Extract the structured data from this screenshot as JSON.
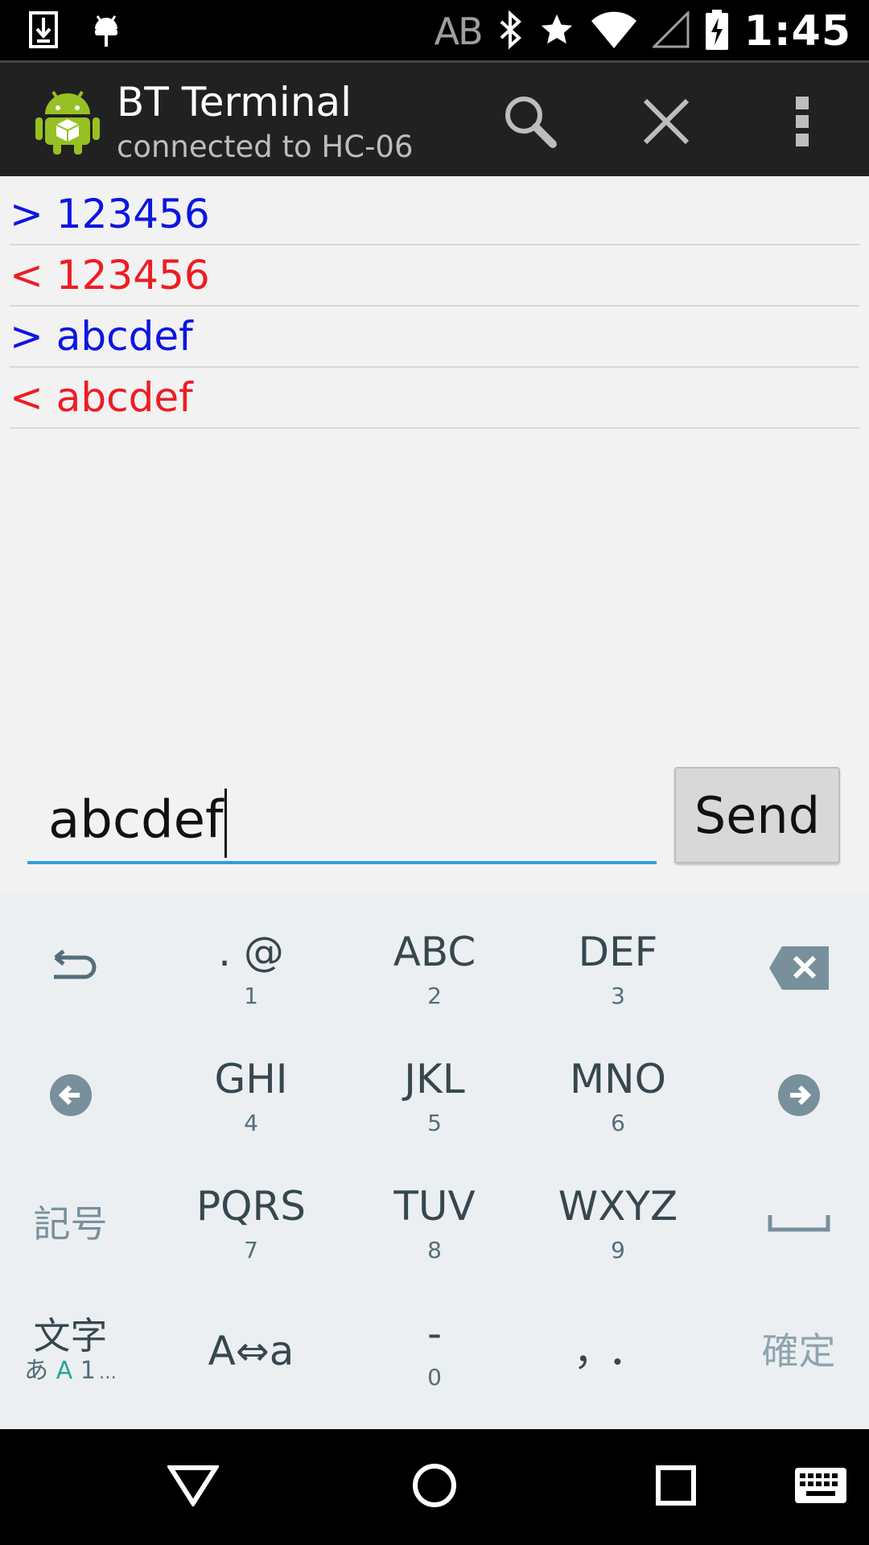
{
  "status_bar": {
    "left_icons": [
      "download-icon",
      "android-debug-icon"
    ],
    "ab_text": "AB",
    "right_icons": [
      "bluetooth-icon",
      "star-icon",
      "wifi-icon",
      "signal-icon",
      "battery-charging-icon"
    ],
    "time": "1:45"
  },
  "action_bar": {
    "title": "BT Terminal",
    "subtitle": "connected to HC-06",
    "actions": [
      "search-icon",
      "close-icon",
      "overflow-menu-icon"
    ]
  },
  "log": [
    {
      "direction": "out",
      "text": "> 123456",
      "color": "#0b16e0"
    },
    {
      "direction": "in",
      "text": "< 123456",
      "color": "#ee1c24"
    },
    {
      "direction": "out",
      "text": "> abcdef",
      "color": "#0b16e0"
    },
    {
      "direction": "in",
      "text": "< abcdef",
      "color": "#ee1c24"
    }
  ],
  "input": {
    "value": "abcdef",
    "accent": "#2ea1d9"
  },
  "send_label": "Send",
  "keyboard": {
    "row1": {
      "k1_main": ". @",
      "k1_sub": "1",
      "k2_main": "ABC",
      "k2_sub": "2",
      "k3_main": "DEF",
      "k3_sub": "3"
    },
    "row2": {
      "k1_main": "GHI",
      "k1_sub": "4",
      "k2_main": "JKL",
      "k2_sub": "5",
      "k3_main": "MNO",
      "k3_sub": "6"
    },
    "row3": {
      "left": "記号",
      "k1_main": "PQRS",
      "k1_sub": "7",
      "k2_main": "TUV",
      "k2_sub": "8",
      "k3_main": "WXYZ",
      "k3_sub": "9",
      "right": "␣"
    },
    "row4": {
      "left_main": "文字",
      "left_a": "あ",
      "left_b": "A",
      "left_c": "1",
      "left_more": "…",
      "k1_main": "A⇔a",
      "k2_main": "-",
      "k2_sub": "0",
      "k3_main": "，．",
      "right": "確定"
    }
  },
  "nav_bar": [
    "back-icon",
    "home-icon",
    "recents-icon",
    "keyboard-icon"
  ]
}
